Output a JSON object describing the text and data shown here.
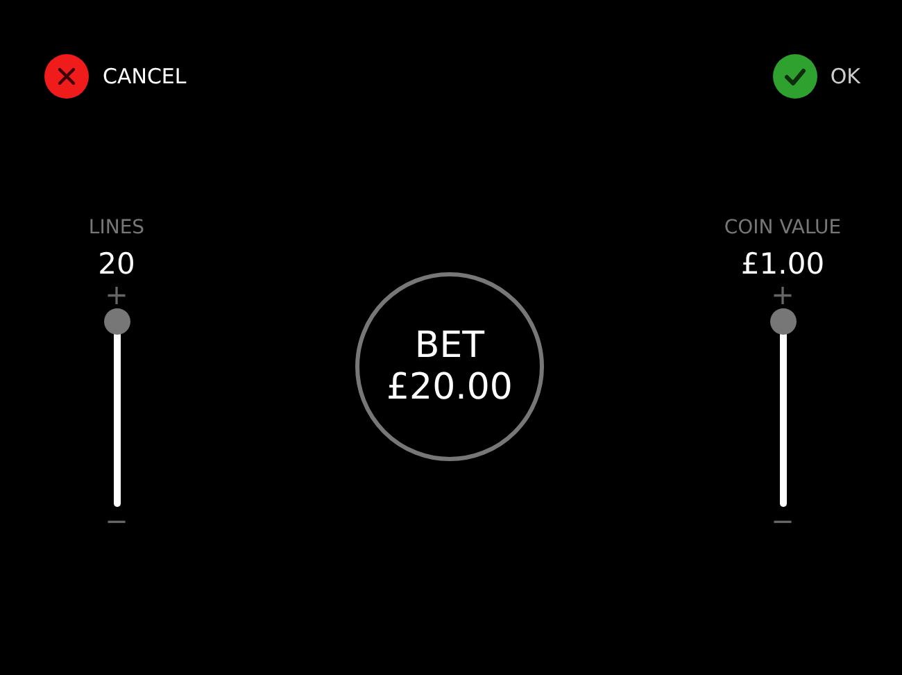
{
  "actions": [
    {
      "kind": "cancel",
      "label": "CANCEL"
    },
    {
      "kind": "ok",
      "label": "OK"
    }
  ],
  "sliders": [
    {
      "label": "LINES",
      "value": "20",
      "plus": "+",
      "minus": "−",
      "level": 1
    },
    {
      "label": "COIN VALUE",
      "value": "£1.00",
      "plus": "+",
      "minus": "−",
      "level": 1
    }
  ],
  "bet": {
    "label": "BET",
    "amount": "£20.00"
  }
}
